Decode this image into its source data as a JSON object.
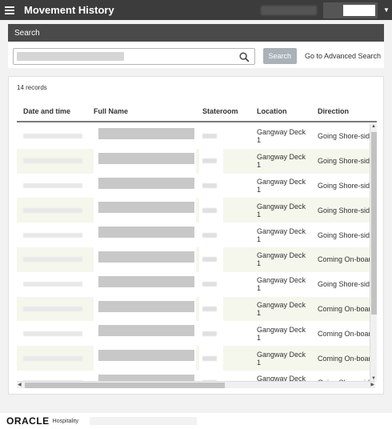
{
  "header": {
    "title": "Movement History",
    "dropdown_icon": "caret-down-icon",
    "menu_icon": "hamburger-icon"
  },
  "search": {
    "heading": "Search",
    "placeholder": "",
    "button_label": "Search",
    "advanced_link": "Go to Advanced Search",
    "icon": "search-icon"
  },
  "results": {
    "count_text": "14 records",
    "columns": [
      "Date and time",
      "Full Name",
      "Stateroom",
      "Location",
      "Direction"
    ],
    "rows": [
      {
        "location": "Gangway Deck 1",
        "direction": "Going Shore-side"
      },
      {
        "location": "Gangway Deck 1",
        "direction": "Going Shore-side"
      },
      {
        "location": "Gangway Deck 1",
        "direction": "Going Shore-side"
      },
      {
        "location": "Gangway Deck 1",
        "direction": "Going Shore-side"
      },
      {
        "location": "Gangway Deck 1",
        "direction": "Going Shore-side"
      },
      {
        "location": "Gangway Deck 1",
        "direction": "Coming On-board"
      },
      {
        "location": "Gangway Deck 1",
        "direction": "Going Shore-side"
      },
      {
        "location": "Gangway Deck 1",
        "direction": "Coming On-board"
      },
      {
        "location": "Gangway Deck 1",
        "direction": "Coming On-board"
      },
      {
        "location": "Gangway Deck 1",
        "direction": "Coming On-board"
      },
      {
        "location": "Gangway Deck 1",
        "direction": "Going Shore-side"
      }
    ]
  },
  "footer": {
    "brand": "ORACLE",
    "sub": "Hospitality"
  },
  "colors": {
    "topbar": "#3c3c3c",
    "row_alt": "#f5f7ec",
    "button": "#aab1b7"
  }
}
